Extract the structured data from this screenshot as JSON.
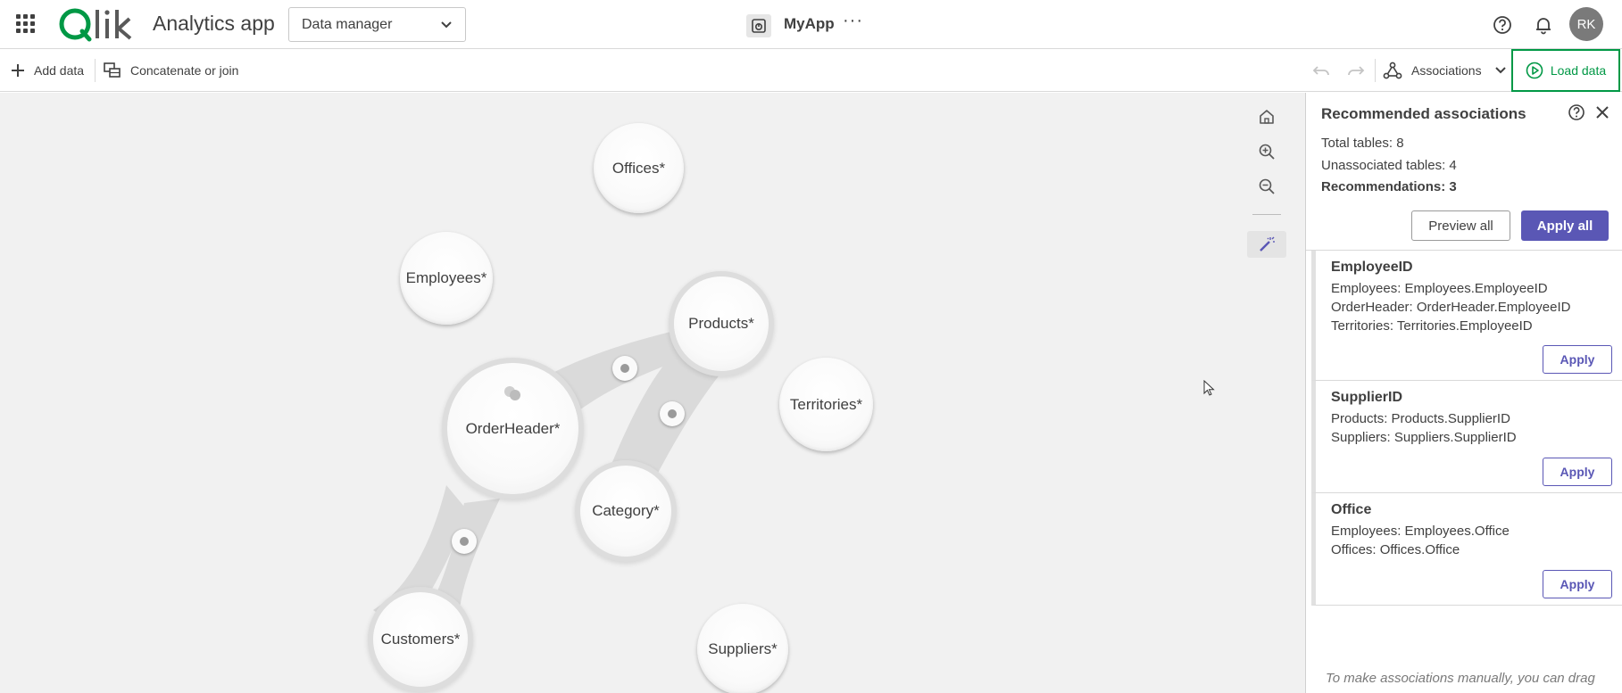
{
  "header": {
    "brand": "Qlik",
    "app_title": "Analytics app",
    "view_dropdown": {
      "selected": "Data manager"
    },
    "app_name": "MyApp",
    "more": "···",
    "user_initials": "RK"
  },
  "toolbar": {
    "add_data": "Add data",
    "concatenate": "Concatenate or join",
    "view_selector": "Associations",
    "load_data": "Load data"
  },
  "canvas": {
    "tables": [
      {
        "name": "Offices*"
      },
      {
        "name": "Employees*"
      },
      {
        "name": "Products*"
      },
      {
        "name": "OrderHeader*"
      },
      {
        "name": "Territories*"
      },
      {
        "name": "Category*"
      },
      {
        "name": "Customers*"
      },
      {
        "name": "Suppliers*"
      }
    ]
  },
  "panel": {
    "title": "Recommended associations",
    "total_tables": "Total tables: 8",
    "unassociated_tables": "Unassociated tables: 4",
    "recommendations": "Recommendations: 3",
    "preview_all": "Preview all",
    "apply_all": "Apply all",
    "items": [
      {
        "title": "EmployeeID",
        "lines": [
          "Employees: Employees.EmployeeID",
          "OrderHeader: OrderHeader.EmployeeID",
          "Territories: Territories.EmployeeID"
        ],
        "apply": "Apply"
      },
      {
        "title": "SupplierID",
        "lines": [
          "Products: Products.SupplierID",
          "Suppliers: Suppliers.SupplierID"
        ],
        "apply": "Apply"
      },
      {
        "title": "Office",
        "lines": [
          "Employees: Employees.Office",
          "Offices: Offices.Office"
        ],
        "apply": "Apply"
      }
    ],
    "hint": "To make associations manually, you can drag"
  },
  "colors": {
    "accent": "#5a57b5",
    "load_green": "#009845",
    "canvas_bg": "#f1f1f1"
  }
}
